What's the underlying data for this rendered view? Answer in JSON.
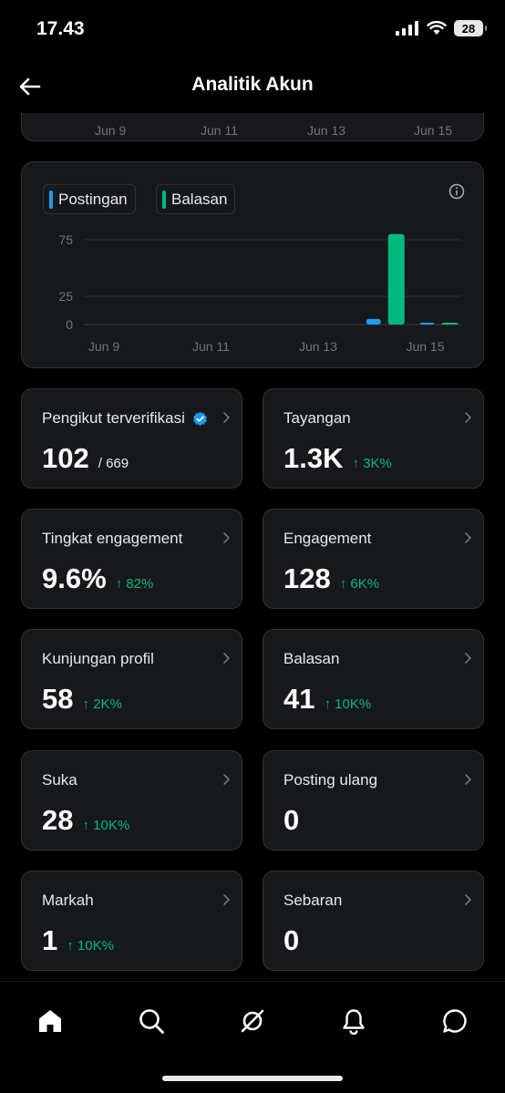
{
  "status_bar": {
    "time": "17.43",
    "battery": "28"
  },
  "header": {
    "title": "Analitik Akun"
  },
  "top_chart": {
    "x_ticks": [
      "Jun 9",
      "Jun 11",
      "Jun 13",
      "Jun 15"
    ]
  },
  "legend": {
    "postingan": "Postingan",
    "balasan": "Balasan"
  },
  "colors": {
    "postingan": "#1d9bf0",
    "balasan": "#00ba7c",
    "positive": "#00ba7c"
  },
  "chart_data": {
    "type": "bar",
    "categories": [
      "Jun 9",
      "Jun 10",
      "Jun 11",
      "Jun 12",
      "Jun 13",
      "Jun 14",
      "Jun 15"
    ],
    "series": [
      {
        "name": "Postingan",
        "values": [
          0,
          0,
          0,
          0,
          0,
          5,
          1
        ]
      },
      {
        "name": "Balasan",
        "values": [
          0,
          0,
          0,
          0,
          0,
          80,
          1
        ]
      }
    ],
    "y_ticks": [
      "75",
      "25",
      "0"
    ],
    "x_ticks": [
      "Jun 9",
      "Jun 11",
      "Jun 13",
      "Jun 15"
    ],
    "ylim": [
      0,
      85
    ],
    "grid": true,
    "legend": "top-left"
  },
  "metrics": [
    {
      "label": "Pengikut terverifikasi",
      "value": "102",
      "sub": "/ 669",
      "change": "",
      "verified": true
    },
    {
      "label": "Tayangan",
      "value": "1.3K",
      "sub": "",
      "change": "↑ 3K%"
    },
    {
      "label": "Tingkat engagement",
      "value": "9.6%",
      "sub": "",
      "change": "↑ 82%"
    },
    {
      "label": "Engagement",
      "value": "128",
      "sub": "",
      "change": "↑ 6K%"
    },
    {
      "label": "Kunjungan profil",
      "value": "58",
      "sub": "",
      "change": "↑ 2K%"
    },
    {
      "label": "Balasan",
      "value": "41",
      "sub": "",
      "change": "↑ 10K%"
    },
    {
      "label": "Suka",
      "value": "28",
      "sub": "",
      "change": "↑ 10K%"
    },
    {
      "label": "Posting ulang",
      "value": "0",
      "sub": "",
      "change": ""
    },
    {
      "label": "Markah",
      "value": "1",
      "sub": "",
      "change": "↑ 10K%"
    },
    {
      "label": "Sebaran",
      "value": "0",
      "sub": "",
      "change": ""
    }
  ],
  "nav": [
    "home-icon",
    "search-icon",
    "grok-icon",
    "notifications-icon",
    "messages-icon"
  ]
}
